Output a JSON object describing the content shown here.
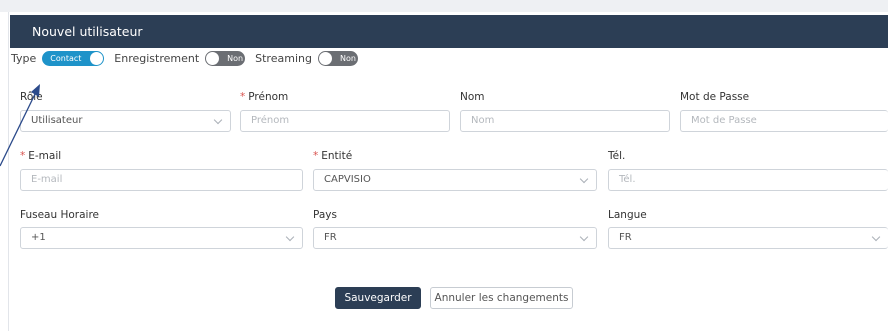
{
  "panel": {
    "title": "Nouvel utilisateur"
  },
  "toggles": {
    "type": {
      "label": "Type",
      "state": "Contact"
    },
    "enregistrement": {
      "label": "Enregistrement",
      "state": "Non"
    },
    "streaming": {
      "label": "Streaming",
      "state": "Non"
    }
  },
  "fields": {
    "role": {
      "label": "Rôle",
      "value": "Utilisateur"
    },
    "prenom": {
      "label": "Prénom",
      "placeholder": "Prénom",
      "required": "*"
    },
    "nom": {
      "label": "Nom",
      "placeholder": "Nom"
    },
    "password": {
      "label": "Mot de Passe",
      "placeholder": "Mot de Passe"
    },
    "email": {
      "label": "E-mail",
      "placeholder": "E-mail",
      "required": "*"
    },
    "entite": {
      "label": "Entité",
      "value": "CAPVISIO",
      "required": "*"
    },
    "tel": {
      "label": "Tél.",
      "placeholder": "Tél."
    },
    "fuseau": {
      "label": "Fuseau Horaire",
      "value": "+1"
    },
    "pays": {
      "label": "Pays",
      "value": "FR"
    },
    "langue": {
      "label": "Langue",
      "value": "FR"
    }
  },
  "actions": {
    "save": "Sauvegarder",
    "cancel": "Annuler les changements"
  },
  "colors": {
    "header": "#2c3e55",
    "toggle_on": "#1e93c9",
    "toggle_off": "#6b6e73",
    "required": "#d9534f"
  },
  "icons": [
    "chevron-down-icon",
    "pointer-arrow-icon"
  ]
}
